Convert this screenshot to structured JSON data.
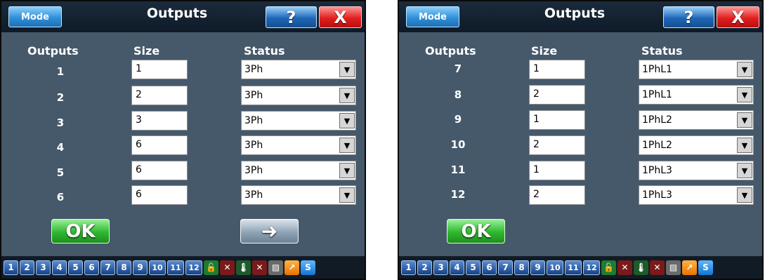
{
  "colors": {
    "panel_bg": "#46596b",
    "titlebar_bg": "#142232",
    "ok_green": "#2eb82e",
    "close_red": "#e11e1e",
    "help_blue": "#1e66b8"
  },
  "panels": [
    {
      "mode_label": "Mode",
      "title": "Outputs",
      "help_glyph": "?",
      "close_glyph": "X",
      "headers": {
        "outputs": "Outputs",
        "size": "Size",
        "status": "Status"
      },
      "rows": [
        {
          "num": "1",
          "size": "1",
          "status": "3Ph"
        },
        {
          "num": "2",
          "size": "2",
          "status": "3Ph"
        },
        {
          "num": "3",
          "size": "3",
          "status": "3Ph"
        },
        {
          "num": "4",
          "size": "6",
          "status": "3Ph"
        },
        {
          "num": "5",
          "size": "6",
          "status": "3Ph"
        },
        {
          "num": "6",
          "size": "6",
          "status": "3Ph"
        }
      ],
      "ok_label": "OK",
      "next_glyph": "➜"
    },
    {
      "mode_label": "Mode",
      "title": "Outputs",
      "help_glyph": "?",
      "close_glyph": "X",
      "headers": {
        "outputs": "Outputs",
        "size": "Size",
        "status": "Status"
      },
      "rows": [
        {
          "num": "7",
          "size": "1",
          "status": "1PhL1"
        },
        {
          "num": "8",
          "size": "2",
          "status": "1PhL1"
        },
        {
          "num": "9",
          "size": "1",
          "status": "1PhL2"
        },
        {
          "num": "10",
          "size": "2",
          "status": "1PhL2"
        },
        {
          "num": "11",
          "size": "1",
          "status": "1PhL3"
        },
        {
          "num": "12",
          "size": "2",
          "status": "1PhL3"
        }
      ],
      "ok_label": "OK"
    }
  ],
  "bottom_bar": {
    "numbers": [
      "1",
      "2",
      "3",
      "4",
      "5",
      "6",
      "7",
      "8",
      "9",
      "10",
      "11",
      "12"
    ],
    "icons": [
      {
        "name": "lock-icon",
        "glyph": "🔓",
        "style": "green"
      },
      {
        "name": "fan-off-icon",
        "glyph": "✕",
        "style": "red"
      },
      {
        "name": "thermometer-icon",
        "glyph": "🌡",
        "style": "thermo"
      },
      {
        "name": "disconnect-icon",
        "glyph": "✕",
        "style": "red"
      },
      {
        "name": "disabled-icon",
        "glyph": "▨",
        "style": "grey"
      },
      {
        "name": "export-icon",
        "glyph": "↗",
        "style": "orange"
      },
      {
        "name": "settings-s-icon",
        "glyph": "S",
        "style": "blue"
      }
    ]
  }
}
